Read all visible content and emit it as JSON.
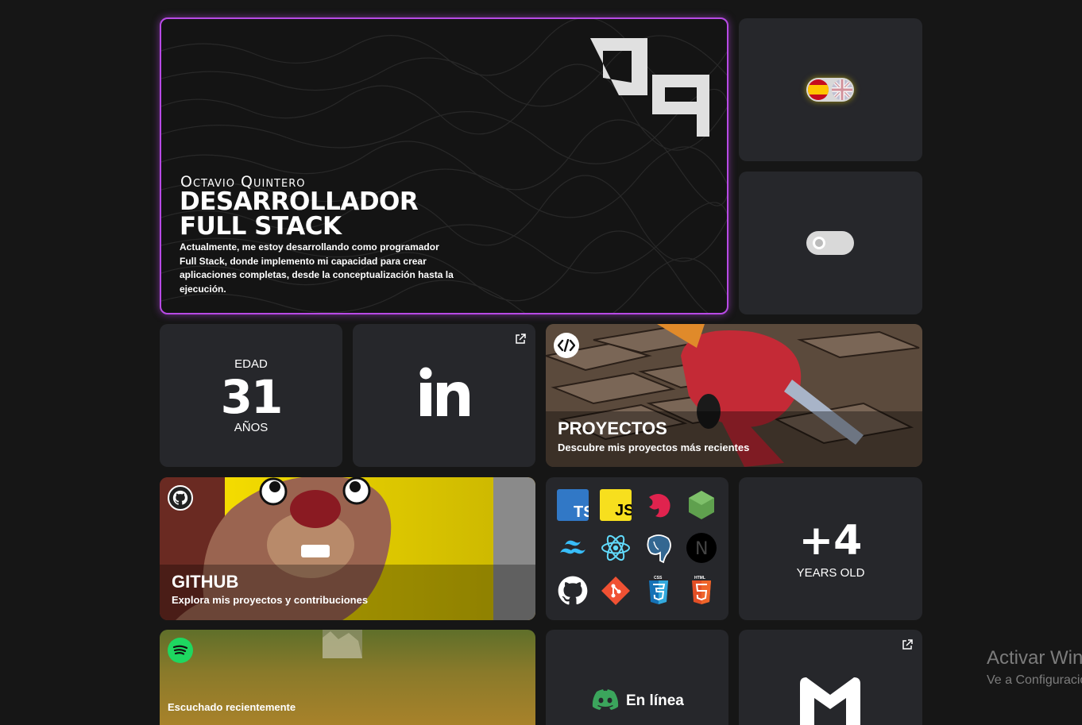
{
  "hero": {
    "name": "Octavio Quintero",
    "role_line1": "DESARROLLADOR",
    "role_line2": "FULL STACK",
    "description": "Actualmente, me estoy desarrollando como programador Full Stack, donde implemento mi capacidad para crear aplicaciones completas, desde la conceptualización hasta la ejecución.",
    "accent": "#b84ae6"
  },
  "toggles": {
    "language": {
      "icons": [
        "spain-flag-icon",
        "uk-flag-icon"
      ]
    },
    "theme": {
      "state": "off"
    }
  },
  "age": {
    "label_top": "EDAD",
    "value": "31",
    "label_bottom": "AÑOS"
  },
  "linkedin": {
    "icon": "linkedin-icon"
  },
  "projects": {
    "title": "PROYECTOS",
    "subtitle": "Descubre mis proyectos más recientes"
  },
  "github": {
    "title": "GITHUB",
    "subtitle": "Explora mis proyectos y contribuciones"
  },
  "tech": {
    "icons": [
      "typescript-icon",
      "javascript-icon",
      "nestjs-icon",
      "nodejs-icon",
      "tailwind-icon",
      "react-icon",
      "postgresql-icon",
      "nextjs-icon",
      "github-icon",
      "git-icon",
      "css3-icon",
      "html5-icon"
    ],
    "ts_label": "TS",
    "js_label": "JS",
    "next_label": "N",
    "css_label": "CSS",
    "html_label": "HTML"
  },
  "experience": {
    "value": "+4",
    "label": "YEARS OLD"
  },
  "spotify": {
    "label": "Escuchado recientemente"
  },
  "discord": {
    "status": "En línea"
  },
  "windows_watermark": {
    "line1": "Activar Windows",
    "line2": "Ve a Configuración"
  }
}
